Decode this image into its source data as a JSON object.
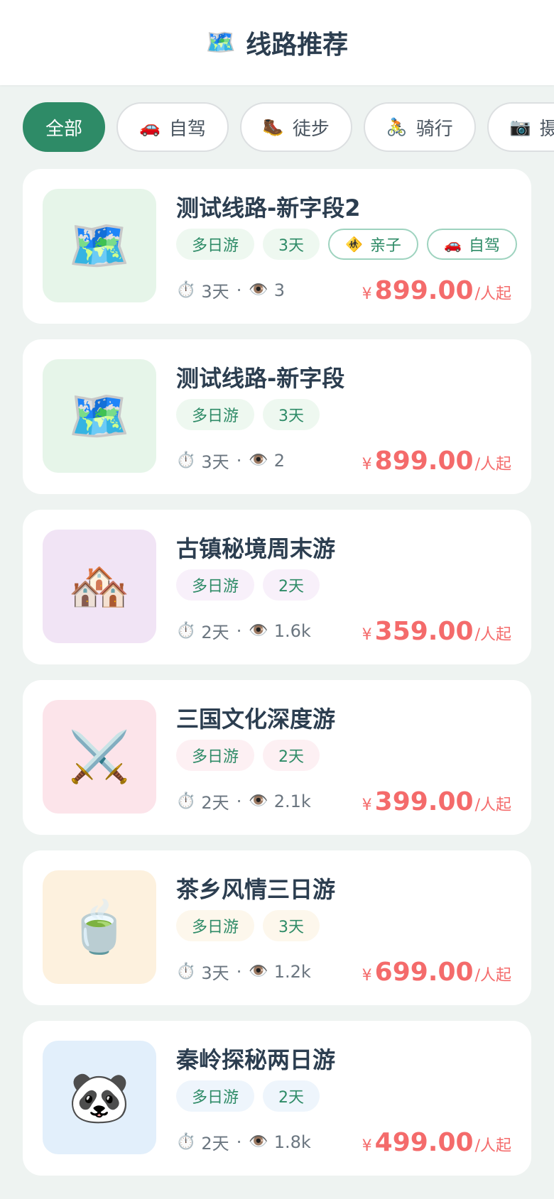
{
  "header": {
    "icon": "map-icon",
    "icon_glyph": "🗺️",
    "title": "线路推荐"
  },
  "filters": [
    {
      "label": "全部",
      "icon": "",
      "icon_name": "",
      "active": true
    },
    {
      "label": "自驾",
      "icon": "🚗",
      "icon_name": "car-icon",
      "active": false
    },
    {
      "label": "徒步",
      "icon": "🥾",
      "icon_name": "hiking-boot-icon",
      "active": false
    },
    {
      "label": "骑行",
      "icon": "🚴",
      "icon_name": "cyclist-icon",
      "active": false
    },
    {
      "label": "摄影",
      "icon": "📷",
      "icon_name": "camera-icon",
      "active": false
    }
  ],
  "routes": [
    {
      "title": "测试线路-新字段2",
      "thumb_glyph": "🗺️",
      "thumb_icon": "map-icon",
      "thumb_bg": "#e6f5e9",
      "tag_bg": "#eef8f0",
      "tags": [
        "多日游",
        "3天"
      ],
      "extra_tags": [
        {
          "icon": "🚸",
          "icon_name": "family-icon",
          "label": "亲子"
        },
        {
          "icon": "🚗",
          "icon_name": "car-icon",
          "label": "自驾"
        }
      ],
      "duration": "3天",
      "views": "3",
      "price_symbol": "¥",
      "price": "899.00",
      "price_unit": "/人起"
    },
    {
      "title": "测试线路-新字段",
      "thumb_glyph": "🗺️",
      "thumb_icon": "map-icon",
      "thumb_bg": "#e6f5e9",
      "tag_bg": "#eef8f0",
      "tags": [
        "多日游",
        "3天"
      ],
      "extra_tags": [],
      "duration": "3天",
      "views": "2",
      "price_symbol": "¥",
      "price": "899.00",
      "price_unit": "/人起"
    },
    {
      "title": "古镇秘境周末游",
      "thumb_glyph": "🏘️",
      "thumb_icon": "houses-icon",
      "thumb_bg": "#f1e4f5",
      "tag_bg": "#f8f0fa",
      "tags": [
        "多日游",
        "2天"
      ],
      "extra_tags": [],
      "duration": "2天",
      "views": "1.6k",
      "price_symbol": "¥",
      "price": "359.00",
      "price_unit": "/人起"
    },
    {
      "title": "三国文化深度游",
      "thumb_glyph": "⚔️",
      "thumb_icon": "crossed-swords-icon",
      "thumb_bg": "#fce4ea",
      "tag_bg": "#fdf0f3",
      "tags": [
        "多日游",
        "2天"
      ],
      "extra_tags": [],
      "duration": "2天",
      "views": "2.1k",
      "price_symbol": "¥",
      "price": "399.00",
      "price_unit": "/人起"
    },
    {
      "title": "茶乡风情三日游",
      "thumb_glyph": "🍵",
      "thumb_icon": "tea-cup-icon",
      "thumb_bg": "#fdf1de",
      "tag_bg": "#fdf7ec",
      "tags": [
        "多日游",
        "3天"
      ],
      "extra_tags": [],
      "duration": "3天",
      "views": "1.2k",
      "price_symbol": "¥",
      "price": "699.00",
      "price_unit": "/人起"
    },
    {
      "title": "秦岭探秘两日游",
      "thumb_glyph": "🐼",
      "thumb_icon": "panda-icon",
      "thumb_bg": "#e2effb",
      "tag_bg": "#eef5fc",
      "tags": [
        "多日游",
        "2天"
      ],
      "extra_tags": [],
      "duration": "2天",
      "views": "1.8k",
      "price_symbol": "¥",
      "price": "499.00",
      "price_unit": "/人起"
    }
  ],
  "meta_icons": {
    "duration_glyph": "⏱️",
    "duration_icon": "stopwatch-icon",
    "views_glyph": "👁️",
    "views_icon": "eye-icon",
    "separator": "·"
  },
  "colors": {
    "accent": "#2e8b67",
    "price": "#f46b6b",
    "background": "#eef3f1"
  }
}
